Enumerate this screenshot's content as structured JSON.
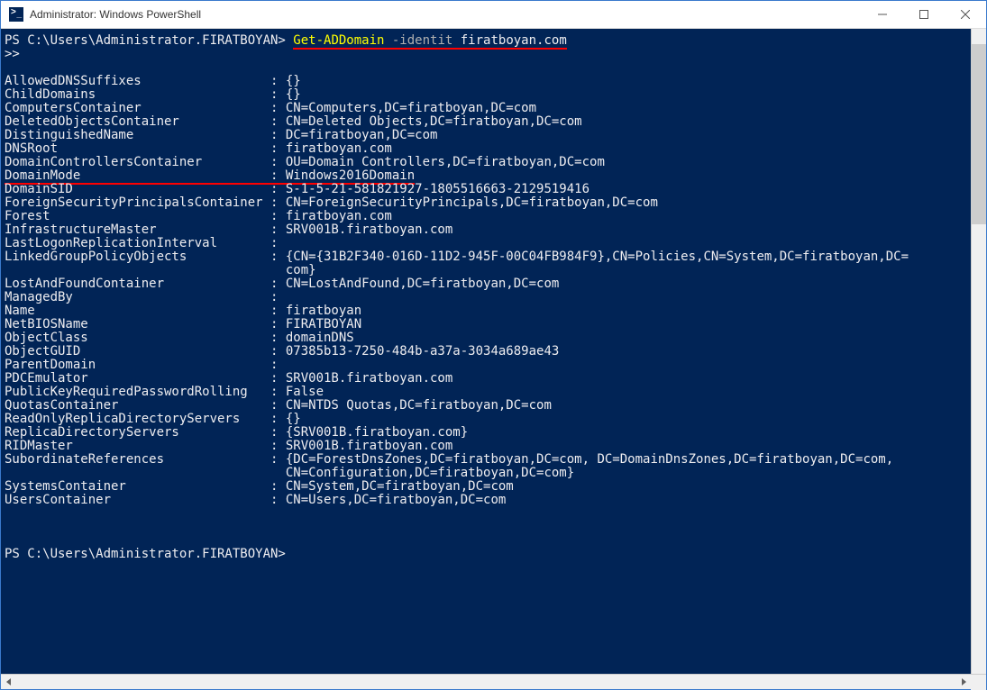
{
  "window": {
    "title": "Administrator: Windows PowerShell"
  },
  "prompt1": {
    "prefix": "PS C:\\Users\\Administrator.FIRATBOYAN> ",
    "cmd": "Get-ADDomain",
    "param": " -identit ",
    "arg": "firatboyan.com"
  },
  "continuation": ">>",
  "properties": [
    {
      "name": "AllowedDNSSuffixes",
      "value": "{}"
    },
    {
      "name": "ChildDomains",
      "value": "{}"
    },
    {
      "name": "ComputersContainer",
      "value": "CN=Computers,DC=firatboyan,DC=com"
    },
    {
      "name": "DeletedObjectsContainer",
      "value": "CN=Deleted Objects,DC=firatboyan,DC=com"
    },
    {
      "name": "DistinguishedName",
      "value": "DC=firatboyan,DC=com"
    },
    {
      "name": "DNSRoot",
      "value": "firatboyan.com"
    },
    {
      "name": "DomainControllersContainer",
      "value": "OU=Domain Controllers,DC=firatboyan,DC=com"
    },
    {
      "name": "DomainMode",
      "value": "Windows2016Domain",
      "underline": true
    },
    {
      "name": "DomainSID",
      "value": "S-1-5-21-581821927-1805516663-2129519416"
    },
    {
      "name": "ForeignSecurityPrincipalsContainer",
      "value": "CN=ForeignSecurityPrincipals,DC=firatboyan,DC=com"
    },
    {
      "name": "Forest",
      "value": "firatboyan.com"
    },
    {
      "name": "InfrastructureMaster",
      "value": "SRV001B.firatboyan.com"
    },
    {
      "name": "LastLogonReplicationInterval",
      "value": ""
    },
    {
      "name": "LinkedGroupPolicyObjects",
      "value": "{CN={31B2F340-016D-11D2-945F-00C04FB984F9},CN=Policies,CN=System,DC=firatboyan,DC=\n                                     com}"
    },
    {
      "name": "LostAndFoundContainer",
      "value": "CN=LostAndFound,DC=firatboyan,DC=com"
    },
    {
      "name": "ManagedBy",
      "value": ""
    },
    {
      "name": "Name",
      "value": "firatboyan"
    },
    {
      "name": "NetBIOSName",
      "value": "FIRATBOYAN"
    },
    {
      "name": "ObjectClass",
      "value": "domainDNS"
    },
    {
      "name": "ObjectGUID",
      "value": "07385b13-7250-484b-a37a-3034a689ae43"
    },
    {
      "name": "ParentDomain",
      "value": ""
    },
    {
      "name": "PDCEmulator",
      "value": "SRV001B.firatboyan.com"
    },
    {
      "name": "PublicKeyRequiredPasswordRolling",
      "value": "False"
    },
    {
      "name": "QuotasContainer",
      "value": "CN=NTDS Quotas,DC=firatboyan,DC=com"
    },
    {
      "name": "ReadOnlyReplicaDirectoryServers",
      "value": "{}"
    },
    {
      "name": "ReplicaDirectoryServers",
      "value": "{SRV001B.firatboyan.com}"
    },
    {
      "name": "RIDMaster",
      "value": "SRV001B.firatboyan.com"
    },
    {
      "name": "SubordinateReferences",
      "value": "{DC=ForestDnsZones,DC=firatboyan,DC=com, DC=DomainDnsZones,DC=firatboyan,DC=com,\n                                     CN=Configuration,DC=firatboyan,DC=com}"
    },
    {
      "name": "SystemsContainer",
      "value": "CN=System,DC=firatboyan,DC=com"
    },
    {
      "name": "UsersContainer",
      "value": "CN=Users,DC=firatboyan,DC=com"
    }
  ],
  "prompt2": "PS C:\\Users\\Administrator.FIRATBOYAN>",
  "layout": {
    "nameColumnWidth": 35
  }
}
